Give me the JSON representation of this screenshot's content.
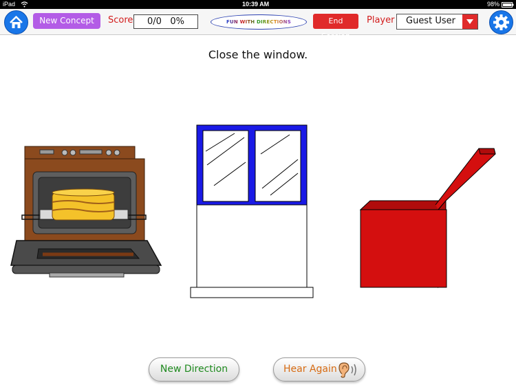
{
  "status_bar": {
    "device": "iPad",
    "time": "10:39 AM",
    "battery": "98%"
  },
  "toolbar": {
    "new_concept_label": "New Concept",
    "score_label": "Score",
    "score_value": "0/0   0%",
    "logo_text": "FUN WITH DIRECTIONS",
    "end_session_label": "End Session",
    "player_label": "Player",
    "player_value": "Guest User"
  },
  "main": {
    "instruction": "Close the window.",
    "choices": [
      {
        "name": "oven"
      },
      {
        "name": "window"
      },
      {
        "name": "box"
      }
    ]
  },
  "bottom": {
    "new_direction_label": "New Direction",
    "hear_again_label": "Hear Again"
  },
  "colors": {
    "accent_blue": "#1976e8",
    "purple": "#b35ce6",
    "red": "#e02a2a",
    "window_frame": "#1a1ae6",
    "box_red": "#d40f0f"
  },
  "icons": [
    "home-icon",
    "gear-icon",
    "ear-icon",
    "dropdown-arrow-icon",
    "wifi-icon",
    "battery-icon"
  ]
}
